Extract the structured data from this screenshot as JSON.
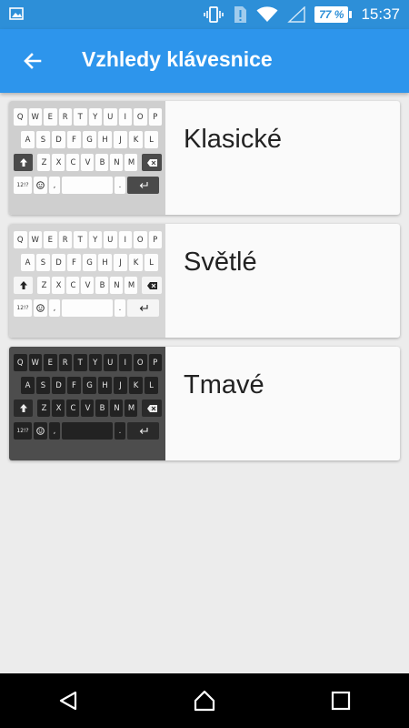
{
  "status_bar": {
    "time": "15:37",
    "battery": "77 %",
    "icons": [
      "image-icon",
      "vibrate-icon",
      "sim-alert-icon",
      "wifi-icon",
      "signal-icon"
    ]
  },
  "app_bar": {
    "title": "Vzhledy klávesnice",
    "back_icon": "arrow-back-icon"
  },
  "keyboard_preview": {
    "row1": [
      "Q",
      "W",
      "E",
      "R",
      "T",
      "Y",
      "U",
      "I",
      "O",
      "P"
    ],
    "row2": [
      "A",
      "S",
      "D",
      "F",
      "G",
      "H",
      "J",
      "K",
      "L"
    ],
    "row3": [
      "Z",
      "X",
      "C",
      "V",
      "B",
      "N",
      "M"
    ],
    "symbols_key": "12!?",
    "comma_key": ",",
    "period_key": "."
  },
  "themes": [
    {
      "name": "Klasické",
      "style": "classic"
    },
    {
      "name": "Světlé",
      "style": "light"
    },
    {
      "name": "Tmavé",
      "style": "dark"
    }
  ],
  "colors": {
    "status_bar": "#2d8fd8",
    "app_bar": "#2d95ec",
    "background": "#ececec"
  },
  "nav_bar": {
    "icons": [
      "back-triangle-icon",
      "home-icon",
      "recents-square-icon"
    ]
  }
}
